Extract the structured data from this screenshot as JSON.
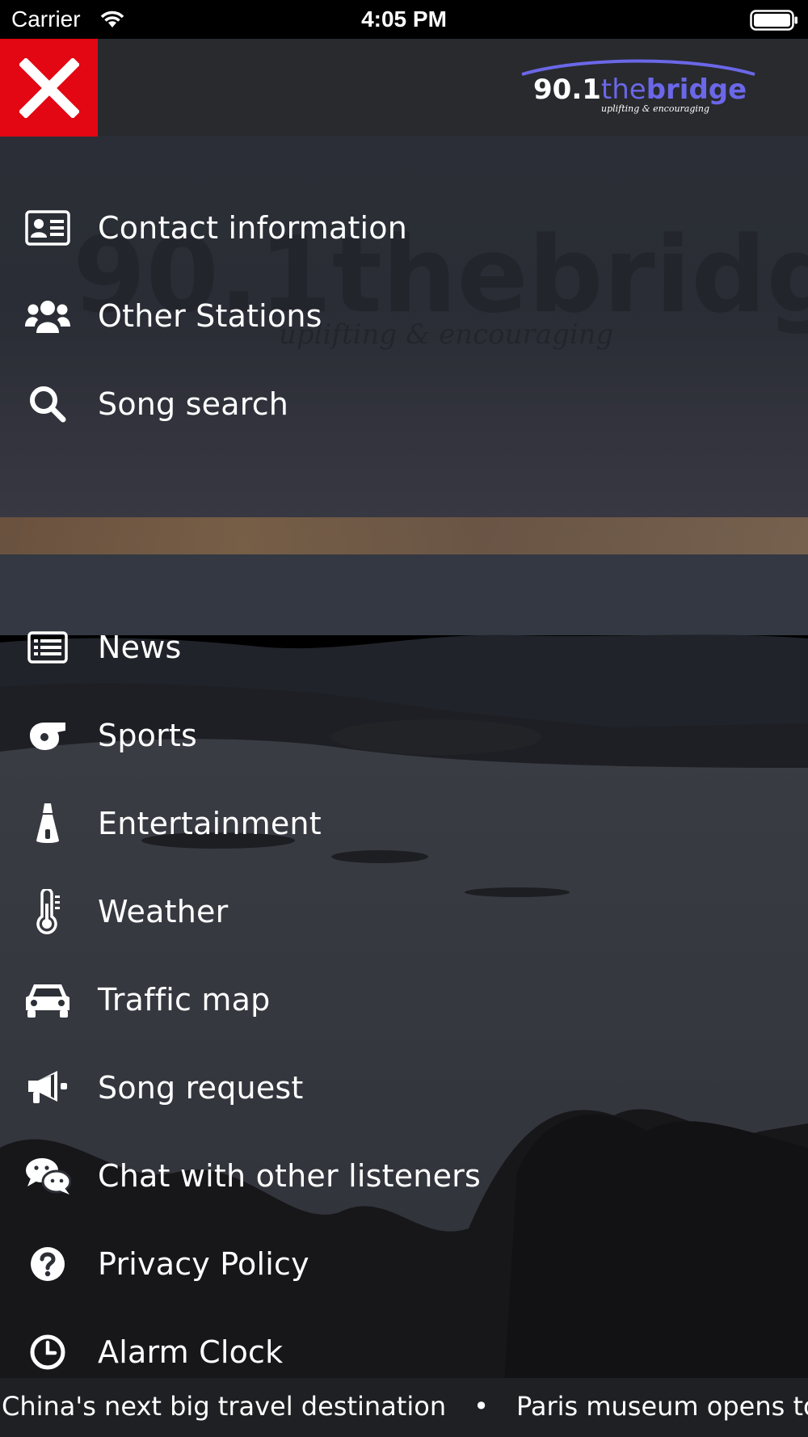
{
  "status_bar": {
    "carrier": "Carrier",
    "time": "4:05 PM"
  },
  "header": {
    "logo_text_main": "90.1",
    "logo_text_the": "the",
    "logo_text_bridge": "bridge",
    "logo_tagline": "uplifting & encouraging",
    "close_icon": "close-icon",
    "accent_color": "#e30613",
    "logo_color": "#6b67e8"
  },
  "menu": {
    "group1": [
      {
        "label": "Contact information",
        "icon": "contact-card-icon"
      },
      {
        "label": "Other Stations",
        "icon": "users-icon"
      },
      {
        "label": "Song search",
        "icon": "search-icon"
      }
    ],
    "group2": [
      {
        "label": "News",
        "icon": "news-icon"
      },
      {
        "label": "Sports",
        "icon": "whistle-icon"
      },
      {
        "label": "Entertainment",
        "icon": "spotlight-icon"
      },
      {
        "label": "Weather",
        "icon": "thermometer-icon"
      },
      {
        "label": "Traffic map",
        "icon": "car-icon"
      },
      {
        "label": "Song request",
        "icon": "megaphone-icon"
      },
      {
        "label": "Chat with other listeners",
        "icon": "chat-icon"
      },
      {
        "label": "Privacy Policy",
        "icon": "question-icon"
      },
      {
        "label": "Alarm Clock",
        "icon": "clock-icon"
      }
    ]
  },
  "ticker": {
    "item1": "China's next big travel destination",
    "separator": "•",
    "item2": "Paris museum opens to nu"
  }
}
